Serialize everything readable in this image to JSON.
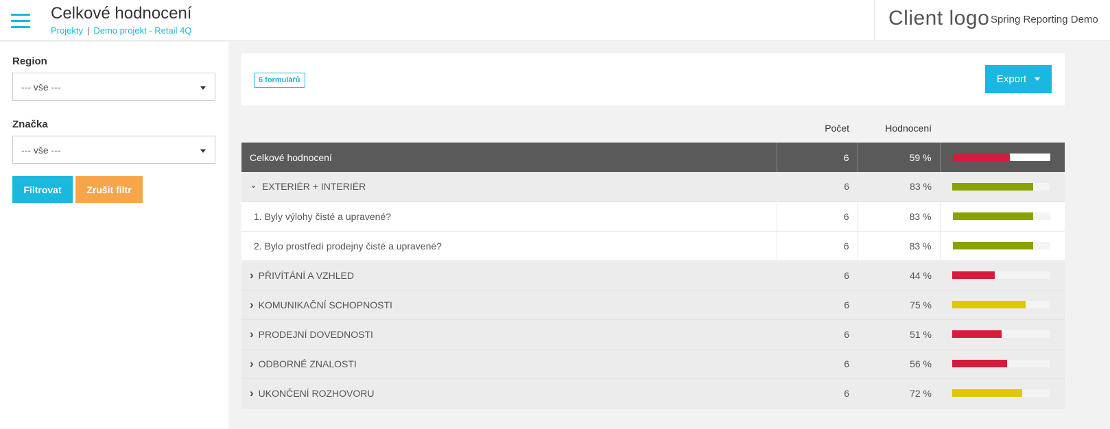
{
  "header": {
    "title": "Celkové hodnocení",
    "breadcrumb": [
      "Projekty",
      "Demo projekt - Retail 4Q"
    ],
    "breadcrumb_sep": "|",
    "client_logo": "Client logo",
    "app_name": "Spring Reporting Demo"
  },
  "sidebar": {
    "region_label": "Region",
    "region_value": "--- vše ---",
    "brand_label": "Značka",
    "brand_value": "--- vše ---",
    "filter_button": "Filtrovat",
    "clear_button": "Zrušit filtr"
  },
  "toolbar": {
    "forms_badge": "6 formulářů",
    "export_button": "Export"
  },
  "table": {
    "columns": [
      "",
      "Počet",
      "Hodnocení",
      ""
    ],
    "rows": [
      {
        "type": "total",
        "label": "Celkové hodnocení",
        "count": "6",
        "score": "59 %",
        "fraction": 0.59,
        "color": "#d41c3c"
      },
      {
        "type": "section",
        "expanded": true,
        "label": "EXTERIÉR + INTERIÉR",
        "count": "6",
        "score": "83 %",
        "fraction": 0.83,
        "color": "#86a300"
      },
      {
        "type": "item",
        "label": "1. Byly výlohy čisté a upravené?",
        "count": "6",
        "score": "83 %",
        "fraction": 0.83,
        "color": "#86a300"
      },
      {
        "type": "item",
        "label": "2. Bylo prostředí prodejny čisté a upravené?",
        "count": "6",
        "score": "83 %",
        "fraction": 0.83,
        "color": "#86a300"
      },
      {
        "type": "section",
        "expanded": false,
        "label": "PŘIVÍTÁNÍ A VZHLED",
        "count": "6",
        "score": "44 %",
        "fraction": 0.44,
        "color": "#d41c3c"
      },
      {
        "type": "section",
        "expanded": false,
        "label": "KOMUNIKAČNÍ SCHOPNOSTI",
        "count": "6",
        "score": "75 %",
        "fraction": 0.75,
        "color": "#e0c800"
      },
      {
        "type": "section",
        "expanded": false,
        "label": "PRODEJNÍ DOVEDNOSTI",
        "count": "6",
        "score": "51 %",
        "fraction": 0.51,
        "color": "#d41c3c"
      },
      {
        "type": "section",
        "expanded": false,
        "label": "ODBORNÉ ZNALOSTI",
        "count": "6",
        "score": "56 %",
        "fraction": 0.56,
        "color": "#d41c3c"
      },
      {
        "type": "section",
        "expanded": false,
        "label": "UKONČENÍ ROZHOVORU",
        "count": "6",
        "score": "72 %",
        "fraction": 0.72,
        "color": "#e0c800"
      }
    ]
  },
  "icons": {
    "menu": "hamburger-menu-icon",
    "expanded": "chevron-down-icon",
    "collapsed": "chevron-right-icon",
    "dropdown": "caret-down-icon"
  },
  "colors": {
    "accent": "#1ab7de",
    "warning": "#f6a54a",
    "bad": "#d41c3c",
    "medium": "#e0c800",
    "good": "#86a300"
  }
}
